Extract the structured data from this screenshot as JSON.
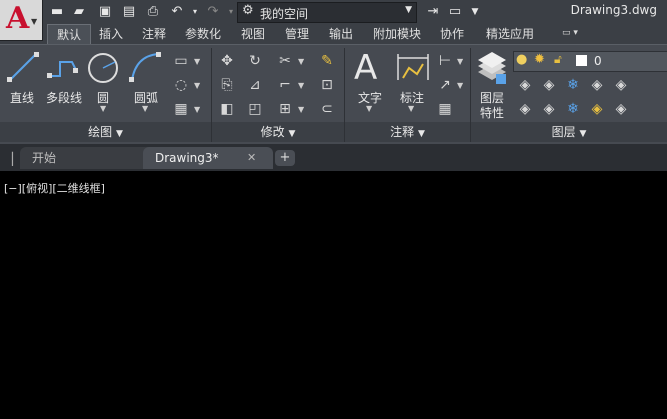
{
  "title_bar": {
    "workspace": "我的空间",
    "document_title": "Drawing3.dwg"
  },
  "ribbon_tabs": [
    "默认",
    "插入",
    "注释",
    "参数化",
    "视图",
    "管理",
    "输出",
    "附加模块",
    "协作",
    "精选应用"
  ],
  "groups": {
    "draw": {
      "title": "绘图",
      "line": "直线",
      "polyline": "多段线",
      "circle": "圆",
      "arc": "圆弧"
    },
    "modify": {
      "title": "修改"
    },
    "annotation": {
      "title": "注释",
      "text": "文字",
      "dimension": "标注"
    },
    "layers": {
      "title": "图层",
      "layer_properties_line1": "图层",
      "layer_properties_line2": "特性",
      "current_layer": "0"
    }
  },
  "file_tabs": [
    "开始",
    "Drawing3*"
  ],
  "viewport_label": "[−][俯视][二维线框]",
  "colors": {
    "app_red": "#c8102e",
    "ribbon_bg": "#464a51",
    "canvas_bg": "#000000"
  }
}
